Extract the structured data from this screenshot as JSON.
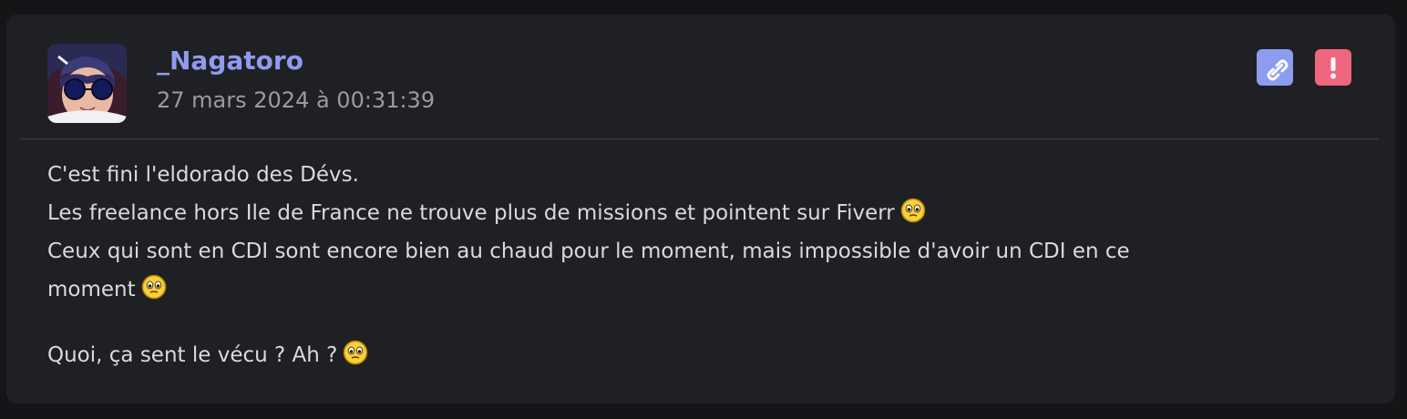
{
  "post": {
    "author": "_Nagatoro",
    "date": "27 mars 2024 à 00:31:39",
    "body": {
      "line1": "C'est fini l'eldorado des Dévs.",
      "line2": "Les freelance hors Ile de France ne trouve plus de missions et pointent sur Fiverr",
      "line3": "Ceux qui sont en CDI sont encore bien au chaud pour le moment, mais impossible d'avoir un CDI en ce",
      "line4": "moment",
      "line5": "Quoi, ça sent le vécu ? Ah ?"
    }
  },
  "icons": {
    "permalink": "link-icon",
    "report": "exclamation-icon",
    "smiley": "pleading-smiley-icon"
  },
  "colors": {
    "username": "#8f9bf0",
    "link_button": "#8c9df0",
    "report_button": "#f0667f",
    "card_background": "#1f2023"
  }
}
